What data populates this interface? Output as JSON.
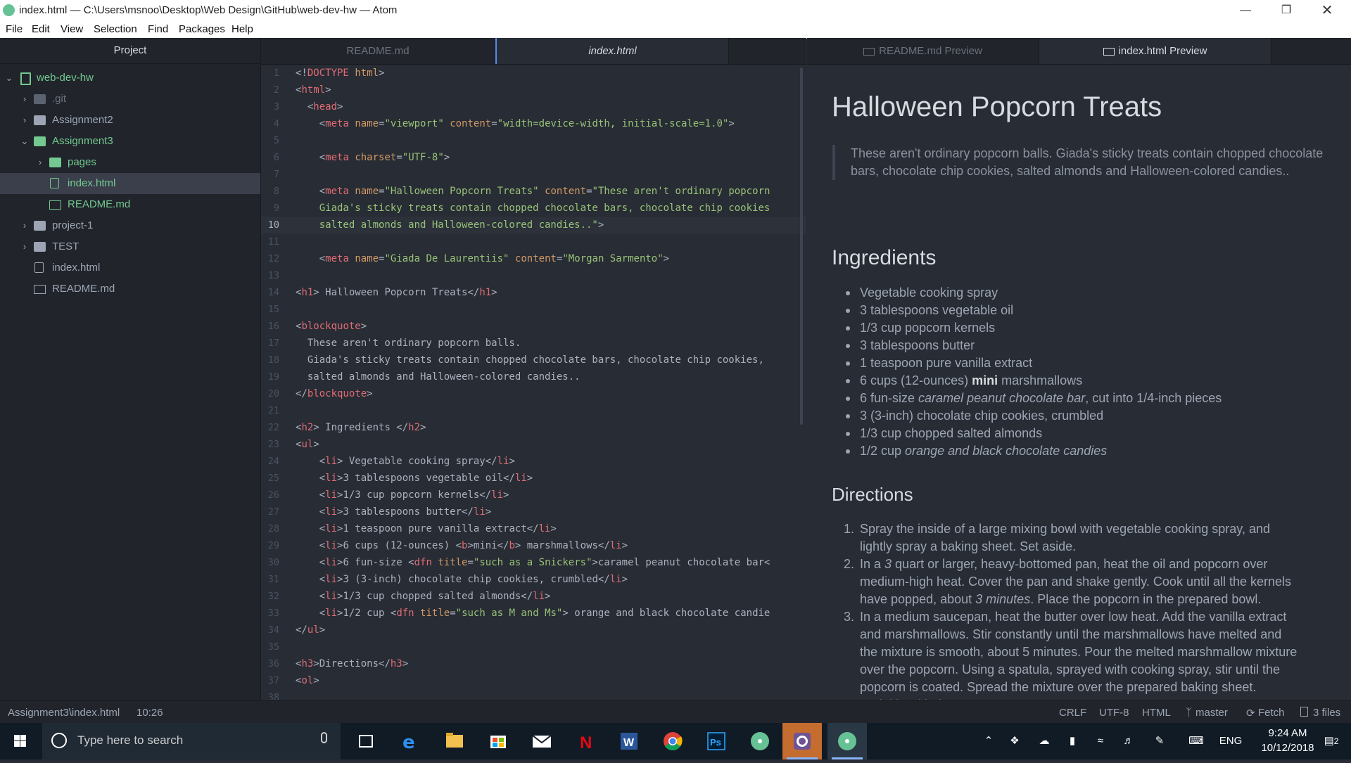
{
  "window": {
    "title": "index.html — C:\\Users\\msnoo\\Desktop\\Web Design\\GitHub\\web-dev-hw — Atom"
  },
  "menu": [
    "File",
    "Edit",
    "View",
    "Selection",
    "Find",
    "Packages",
    "Help"
  ],
  "tree": {
    "header": "Project",
    "items": [
      {
        "label": "web-dev-hw",
        "type": "project"
      },
      {
        "label": ".git",
        "type": "folder"
      },
      {
        "label": "Assignment2",
        "type": "folder"
      },
      {
        "label": "Assignment3",
        "type": "folder"
      },
      {
        "label": "pages",
        "type": "folder"
      },
      {
        "label": "index.html",
        "type": "file"
      },
      {
        "label": "README.md",
        "type": "book"
      },
      {
        "label": "project-1",
        "type": "folder"
      },
      {
        "label": "TEST",
        "type": "folder"
      },
      {
        "label": "index.html",
        "type": "file"
      },
      {
        "label": "README.md",
        "type": "book"
      }
    ]
  },
  "tabs": {
    "left": [
      {
        "label": "README.md"
      },
      {
        "label": "index.html"
      }
    ],
    "right": [
      {
        "label": "README.md Preview"
      },
      {
        "label": "index.html Preview"
      }
    ]
  },
  "code": {
    "lines": [
      {
        "n": "1",
        "segs": [
          {
            "t": "<!",
            "c": "pl"
          },
          {
            "t": "DOCTYPE",
            "c": "tag"
          },
          {
            "t": " ",
            "c": "pl"
          },
          {
            "t": "html",
            "c": "attr"
          },
          {
            "t": ">",
            "c": "pl"
          }
        ]
      },
      {
        "n": "2",
        "segs": [
          {
            "t": "<",
            "c": "pl"
          },
          {
            "t": "html",
            "c": "tag"
          },
          {
            "t": ">",
            "c": "pl"
          }
        ]
      },
      {
        "n": "3",
        "segs": [
          {
            "t": "  <",
            "c": "pl"
          },
          {
            "t": "head",
            "c": "tag"
          },
          {
            "t": ">",
            "c": "pl"
          }
        ]
      },
      {
        "n": "4",
        "segs": [
          {
            "t": "    <",
            "c": "pl"
          },
          {
            "t": "meta",
            "c": "tag"
          },
          {
            "t": " ",
            "c": "pl"
          },
          {
            "t": "name",
            "c": "attr"
          },
          {
            "t": "=",
            "c": "pl"
          },
          {
            "t": "\"viewport\"",
            "c": "str"
          },
          {
            "t": " ",
            "c": "pl"
          },
          {
            "t": "content",
            "c": "attr"
          },
          {
            "t": "=",
            "c": "pl"
          },
          {
            "t": "\"width=device-width, initial-scale=1.0\"",
            "c": "str"
          },
          {
            "t": ">",
            "c": "pl"
          }
        ]
      },
      {
        "n": "5",
        "segs": []
      },
      {
        "n": "6",
        "segs": [
          {
            "t": "    <",
            "c": "pl"
          },
          {
            "t": "meta",
            "c": "tag"
          },
          {
            "t": " ",
            "c": "pl"
          },
          {
            "t": "charset",
            "c": "attr"
          },
          {
            "t": "=",
            "c": "pl"
          },
          {
            "t": "\"UTF-8\"",
            "c": "str"
          },
          {
            "t": ">",
            "c": "pl"
          }
        ]
      },
      {
        "n": "7",
        "segs": []
      },
      {
        "n": "8",
        "segs": [
          {
            "t": "    <",
            "c": "pl"
          },
          {
            "t": "meta",
            "c": "tag"
          },
          {
            "t": " ",
            "c": "pl"
          },
          {
            "t": "name",
            "c": "attr"
          },
          {
            "t": "=",
            "c": "pl"
          },
          {
            "t": "\"Halloween Popcorn Treats\"",
            "c": "str"
          },
          {
            "t": " ",
            "c": "pl"
          },
          {
            "t": "content",
            "c": "attr"
          },
          {
            "t": "=",
            "c": "pl"
          },
          {
            "t": "\"These aren't ordinary popcorn",
            "c": "str"
          }
        ]
      },
      {
        "n": "9",
        "segs": [
          {
            "t": "    Giada's sticky treats contain chopped chocolate bars, chocolate chip cookies",
            "c": "str"
          }
        ]
      },
      {
        "n": "10",
        "segs": [
          {
            "t": "    salted almonds and Halloween-colored candies..\"",
            "c": "str"
          },
          {
            "t": ">",
            "c": "pl"
          }
        ],
        "cur": true
      },
      {
        "n": "11",
        "segs": []
      },
      {
        "n": "12",
        "segs": [
          {
            "t": "    <",
            "c": "pl"
          },
          {
            "t": "meta",
            "c": "tag"
          },
          {
            "t": " ",
            "c": "pl"
          },
          {
            "t": "name",
            "c": "attr"
          },
          {
            "t": "=",
            "c": "pl"
          },
          {
            "t": "\"Giada De Laurentiis\"",
            "c": "str"
          },
          {
            "t": " ",
            "c": "pl"
          },
          {
            "t": "content",
            "c": "attr"
          },
          {
            "t": "=",
            "c": "pl"
          },
          {
            "t": "\"Morgan Sarmento\"",
            "c": "str"
          },
          {
            "t": ">",
            "c": "pl"
          }
        ]
      },
      {
        "n": "13",
        "segs": []
      },
      {
        "n": "14",
        "segs": [
          {
            "t": "<",
            "c": "pl"
          },
          {
            "t": "h1",
            "c": "tag"
          },
          {
            "t": "> Halloween Popcorn Treats</",
            "c": "pl"
          },
          {
            "t": "h1",
            "c": "tag"
          },
          {
            "t": ">",
            "c": "pl"
          }
        ]
      },
      {
        "n": "15",
        "segs": []
      },
      {
        "n": "16",
        "segs": [
          {
            "t": "<",
            "c": "pl"
          },
          {
            "t": "blockquote",
            "c": "tag"
          },
          {
            "t": ">",
            "c": "pl"
          }
        ]
      },
      {
        "n": "17",
        "segs": [
          {
            "t": "  These aren't ordinary popcorn balls.",
            "c": "pl"
          }
        ]
      },
      {
        "n": "18",
        "segs": [
          {
            "t": "  Giada's sticky treats contain chopped chocolate bars, chocolate chip cookies,",
            "c": "pl"
          }
        ]
      },
      {
        "n": "19",
        "segs": [
          {
            "t": "  salted almonds and Halloween-colored candies..",
            "c": "pl"
          }
        ]
      },
      {
        "n": "20",
        "segs": [
          {
            "t": "</",
            "c": "pl"
          },
          {
            "t": "blockquote",
            "c": "tag"
          },
          {
            "t": ">",
            "c": "pl"
          }
        ]
      },
      {
        "n": "21",
        "segs": []
      },
      {
        "n": "22",
        "segs": [
          {
            "t": "<",
            "c": "pl"
          },
          {
            "t": "h2",
            "c": "tag"
          },
          {
            "t": "> Ingredients </",
            "c": "pl"
          },
          {
            "t": "h2",
            "c": "tag"
          },
          {
            "t": ">",
            "c": "pl"
          }
        ]
      },
      {
        "n": "23",
        "segs": [
          {
            "t": "<",
            "c": "pl"
          },
          {
            "t": "ul",
            "c": "tag"
          },
          {
            "t": ">",
            "c": "pl"
          }
        ]
      },
      {
        "n": "24",
        "segs": [
          {
            "t": "    <",
            "c": "pl"
          },
          {
            "t": "li",
            "c": "tag"
          },
          {
            "t": "> Vegetable cooking spray</",
            "c": "pl"
          },
          {
            "t": "li",
            "c": "tag"
          },
          {
            "t": ">",
            "c": "pl"
          }
        ]
      },
      {
        "n": "25",
        "segs": [
          {
            "t": "    <",
            "c": "pl"
          },
          {
            "t": "li",
            "c": "tag"
          },
          {
            "t": ">3 tablespoons vegetable oil</",
            "c": "pl"
          },
          {
            "t": "li",
            "c": "tag"
          },
          {
            "t": ">",
            "c": "pl"
          }
        ]
      },
      {
        "n": "26",
        "segs": [
          {
            "t": "    <",
            "c": "pl"
          },
          {
            "t": "li",
            "c": "tag"
          },
          {
            "t": ">1/3 cup popcorn kernels</",
            "c": "pl"
          },
          {
            "t": "li",
            "c": "tag"
          },
          {
            "t": ">",
            "c": "pl"
          }
        ]
      },
      {
        "n": "27",
        "segs": [
          {
            "t": "    <",
            "c": "pl"
          },
          {
            "t": "li",
            "c": "tag"
          },
          {
            "t": ">3 tablespoons butter</",
            "c": "pl"
          },
          {
            "t": "li",
            "c": "tag"
          },
          {
            "t": ">",
            "c": "pl"
          }
        ]
      },
      {
        "n": "28",
        "segs": [
          {
            "t": "    <",
            "c": "pl"
          },
          {
            "t": "li",
            "c": "tag"
          },
          {
            "t": ">1 teaspoon pure vanilla extract</",
            "c": "pl"
          },
          {
            "t": "li",
            "c": "tag"
          },
          {
            "t": ">",
            "c": "pl"
          }
        ]
      },
      {
        "n": "29",
        "segs": [
          {
            "t": "    <",
            "c": "pl"
          },
          {
            "t": "li",
            "c": "tag"
          },
          {
            "t": ">6 cups (12-ounces) <",
            "c": "pl"
          },
          {
            "t": "b",
            "c": "tag"
          },
          {
            "t": ">mini</",
            "c": "pl"
          },
          {
            "t": "b",
            "c": "tag"
          },
          {
            "t": "> marshmallows</",
            "c": "pl"
          },
          {
            "t": "li",
            "c": "tag"
          },
          {
            "t": ">",
            "c": "pl"
          }
        ]
      },
      {
        "n": "30",
        "segs": [
          {
            "t": "    <",
            "c": "pl"
          },
          {
            "t": "li",
            "c": "tag"
          },
          {
            "t": ">6 fun-size <",
            "c": "pl"
          },
          {
            "t": "dfn",
            "c": "tag"
          },
          {
            "t": " ",
            "c": "pl"
          },
          {
            "t": "title",
            "c": "attr"
          },
          {
            "t": "=",
            "c": "pl"
          },
          {
            "t": "\"such as a Snickers\"",
            "c": "str"
          },
          {
            "t": ">caramel peanut chocolate bar<",
            "c": "pl"
          }
        ]
      },
      {
        "n": "31",
        "segs": [
          {
            "t": "    <",
            "c": "pl"
          },
          {
            "t": "li",
            "c": "tag"
          },
          {
            "t": ">3 (3-inch) chocolate chip cookies, crumbled</",
            "c": "pl"
          },
          {
            "t": "li",
            "c": "tag"
          },
          {
            "t": ">",
            "c": "pl"
          }
        ]
      },
      {
        "n": "32",
        "segs": [
          {
            "t": "    <",
            "c": "pl"
          },
          {
            "t": "li",
            "c": "tag"
          },
          {
            "t": ">1/3 cup chopped salted almonds</",
            "c": "pl"
          },
          {
            "t": "li",
            "c": "tag"
          },
          {
            "t": ">",
            "c": "pl"
          }
        ]
      },
      {
        "n": "33",
        "segs": [
          {
            "t": "    <",
            "c": "pl"
          },
          {
            "t": "li",
            "c": "tag"
          },
          {
            "t": ">1/2 cup <",
            "c": "pl"
          },
          {
            "t": "dfn",
            "c": "tag"
          },
          {
            "t": " ",
            "c": "pl"
          },
          {
            "t": "title",
            "c": "attr"
          },
          {
            "t": "=",
            "c": "pl"
          },
          {
            "t": "\"such as M and Ms\"",
            "c": "str"
          },
          {
            "t": "> orange and black chocolate candie",
            "c": "pl"
          }
        ]
      },
      {
        "n": "34",
        "segs": [
          {
            "t": "</",
            "c": "pl"
          },
          {
            "t": "ul",
            "c": "tag"
          },
          {
            "t": ">",
            "c": "pl"
          }
        ]
      },
      {
        "n": "35",
        "segs": []
      },
      {
        "n": "36",
        "segs": [
          {
            "t": "<",
            "c": "pl"
          },
          {
            "t": "h3",
            "c": "tag"
          },
          {
            "t": ">Directions</",
            "c": "pl"
          },
          {
            "t": "h3",
            "c": "tag"
          },
          {
            "t": ">",
            "c": "pl"
          }
        ]
      },
      {
        "n": "37",
        "segs": [
          {
            "t": "<",
            "c": "pl"
          },
          {
            "t": "ol",
            "c": "tag"
          },
          {
            "t": ">",
            "c": "pl"
          }
        ]
      },
      {
        "n": "38",
        "segs": []
      }
    ]
  },
  "preview": {
    "h1": "Halloween Popcorn Treats",
    "blockquote": "These aren't ordinary popcorn balls. Giada's sticky treats contain chopped chocolate bars, chocolate chip cookies, salted almonds and Halloween-colored candies..",
    "h2": "Ingredients",
    "ingredients": [
      [
        {
          "t": "Vegetable cooking spray"
        }
      ],
      [
        {
          "t": "3 tablespoons vegetable oil"
        }
      ],
      [
        {
          "t": "1/3 cup popcorn kernels"
        }
      ],
      [
        {
          "t": "3 tablespoons butter"
        }
      ],
      [
        {
          "t": "1 teaspoon pure vanilla extract"
        }
      ],
      [
        {
          "t": "6 cups (12-ounces) "
        },
        {
          "t": "mini",
          "s": "b"
        },
        {
          "t": " marshmallows"
        }
      ],
      [
        {
          "t": "6 fun-size "
        },
        {
          "t": "caramel peanut chocolate bar",
          "s": "i"
        },
        {
          "t": ", cut into 1/4-inch pieces"
        }
      ],
      [
        {
          "t": "3 (3-inch) chocolate chip cookies, crumbled"
        }
      ],
      [
        {
          "t": "1/3 cup chopped salted almonds"
        }
      ],
      [
        {
          "t": "1/2 cup "
        },
        {
          "t": "orange and black chocolate candies",
          "s": "i"
        }
      ]
    ],
    "h3": "Directions",
    "directions": [
      [
        {
          "t": "Spray the inside of a large mixing bowl with vegetable cooking spray, and lightly spray a baking sheet. Set aside."
        }
      ],
      [
        {
          "t": "In a "
        },
        {
          "t": "3",
          "s": "i"
        },
        {
          "t": " quart or larger, heavy-bottomed pan, heat the oil and popcorn over medium-high heat. Cover the pan and shake gently. Cook until all the kernels have popped, about "
        },
        {
          "t": "3 minutes",
          "s": "i"
        },
        {
          "t": ". Place the popcorn in the prepared bowl."
        }
      ],
      [
        {
          "t": "In a medium saucepan, heat the butter over low heat. Add the vanilla extract and marshmallows. Stir constantly until the marshmallows have melted and the mixture is smooth, about 5 minutes. Pour the melted marshmallow mixture over the popcorn. Using a spatula, sprayed with cooking spray, stir until the popcorn is coated. Spread the mixture over the prepared baking sheet. Sprinkle with the"
        }
      ]
    ]
  },
  "status": {
    "path": "Assignment3\\index.html",
    "cursor": "10:26",
    "line_ending": "CRLF",
    "encoding": "UTF-8",
    "grammar": "HTML",
    "branch": "master",
    "fetch": "Fetch",
    "files": "3 files"
  },
  "taskbar": {
    "search_placeholder": "Type here to search",
    "lang": "ENG",
    "time": "9:24 AM",
    "date": "10/12/2018",
    "notif_count": "2"
  },
  "colors": {
    "tag": "#e06c75",
    "attr": "#d19a66",
    "string": "#98c379",
    "plain": "#abb2bf",
    "git_new": "#73c990"
  }
}
